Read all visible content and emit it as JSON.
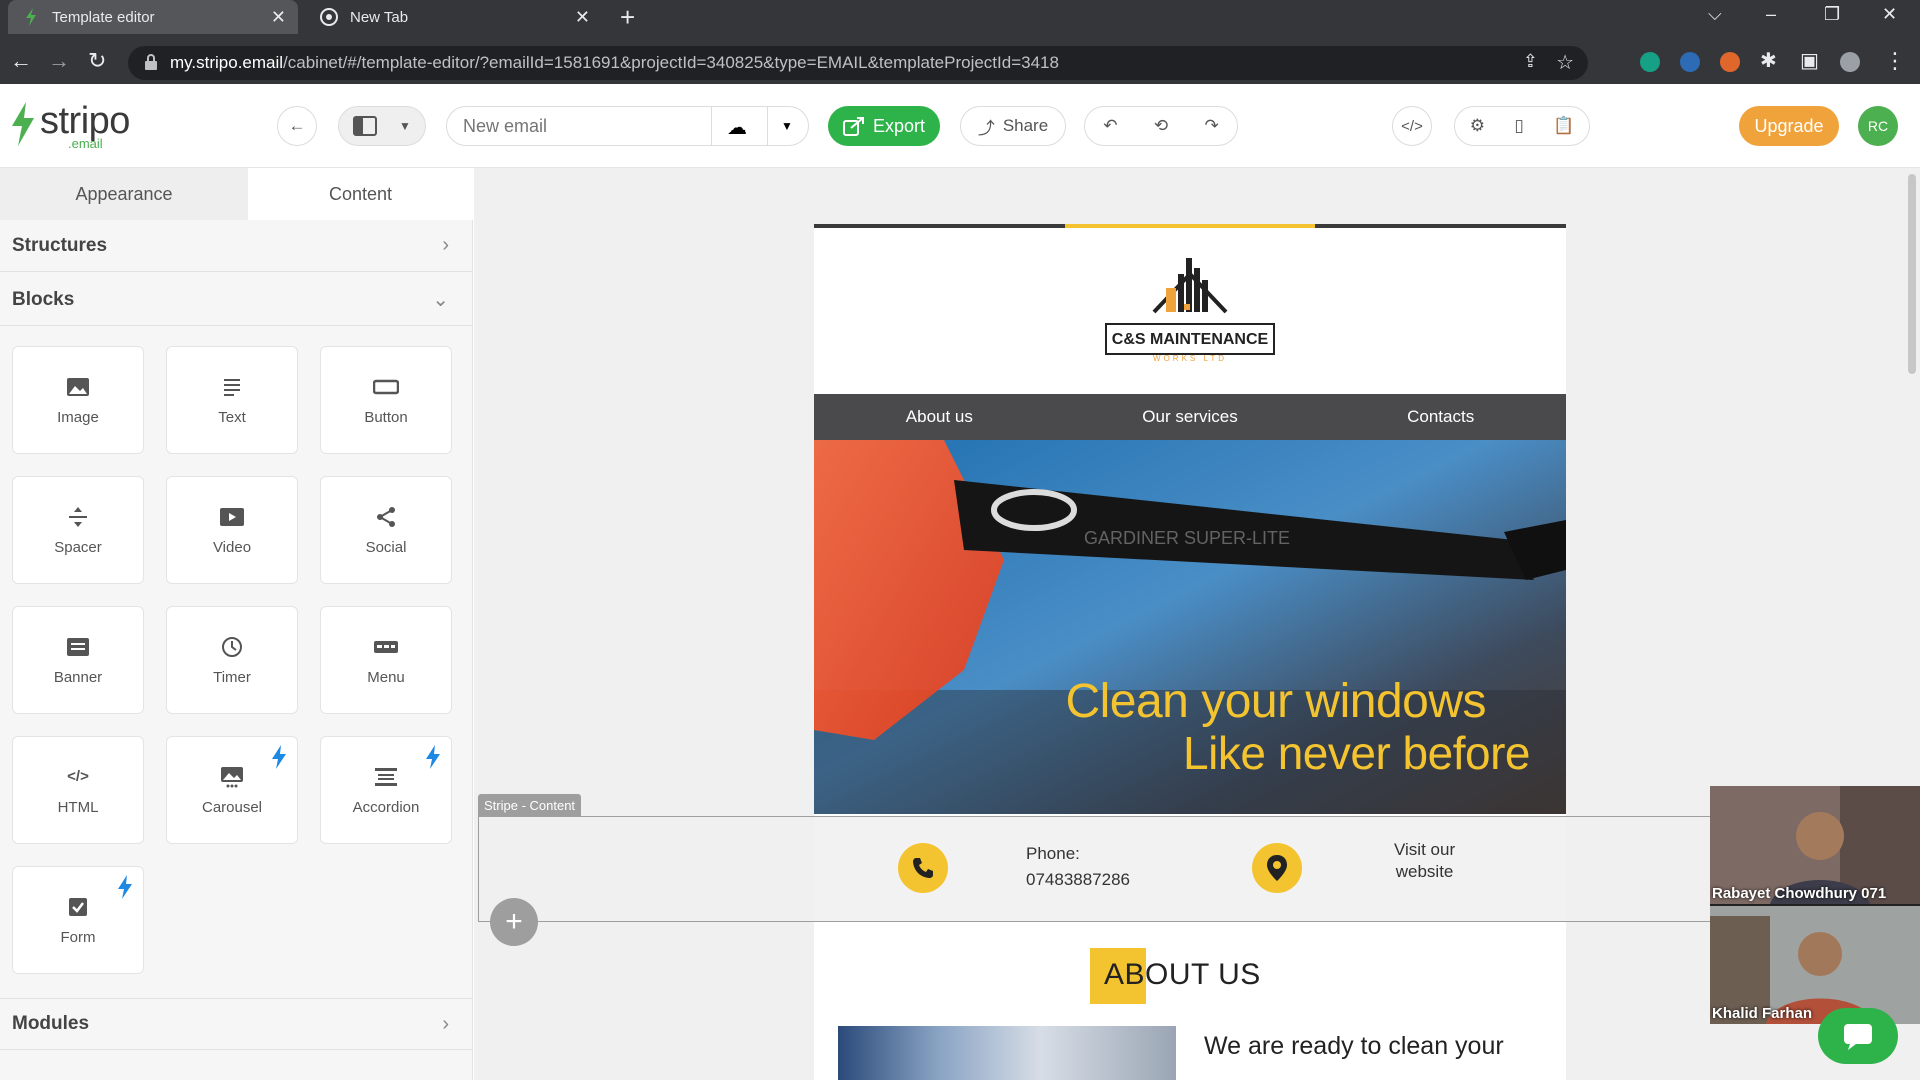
{
  "browser": {
    "tabs": [
      {
        "title": "Template editor",
        "active": true
      },
      {
        "title": "New Tab",
        "active": false
      }
    ],
    "url_host": "my.stripo.email",
    "url_path": "/cabinet/#/template-editor/?emailId=1581691&projectId=340825&type=EMAIL&templateProjectId=3418"
  },
  "toolbar": {
    "logo_text": "stripo",
    "logo_sub": ".email",
    "email_name_placeholder": "New email",
    "export_label": "Export",
    "share_label": "Share",
    "upgrade_label": "Upgrade",
    "avatar_initials": "RC"
  },
  "panel": {
    "tab_appearance": "Appearance",
    "tab_content": "Content",
    "section_structures": "Structures",
    "section_blocks": "Blocks",
    "section_modules": "Modules",
    "blocks": [
      {
        "label": "Image",
        "icon": "image-icon",
        "bolt": false
      },
      {
        "label": "Text",
        "icon": "text-icon",
        "bolt": false
      },
      {
        "label": "Button",
        "icon": "button-icon",
        "bolt": false
      },
      {
        "label": "Spacer",
        "icon": "spacer-icon",
        "bolt": false
      },
      {
        "label": "Video",
        "icon": "video-icon",
        "bolt": false
      },
      {
        "label": "Social",
        "icon": "social-icon",
        "bolt": false
      },
      {
        "label": "Banner",
        "icon": "banner-icon",
        "bolt": false
      },
      {
        "label": "Timer",
        "icon": "timer-icon",
        "bolt": false
      },
      {
        "label": "Menu",
        "icon": "menu-icon",
        "bolt": false
      },
      {
        "label": "HTML",
        "icon": "html-icon",
        "bolt": false
      },
      {
        "label": "Carousel",
        "icon": "carousel-icon",
        "bolt": true
      },
      {
        "label": "Accordion",
        "icon": "accordion-icon",
        "bolt": true
      },
      {
        "label": "Form",
        "icon": "form-icon",
        "bolt": true
      }
    ]
  },
  "email": {
    "logo_name": "C&S MAINTENANCE",
    "logo_sub": "WORKS LTD",
    "nav": [
      "About us",
      "Our services",
      "Contacts"
    ],
    "hero_line1": "Clean your windows",
    "hero_line2": "Like never before",
    "stripe_label": "Stripe - Content",
    "phone_label": "Phone:",
    "phone_number": "07483887286",
    "visit_line1": "Visit our",
    "visit_line2": "website",
    "about_title": "ABOUT US",
    "about_text": "We are ready to clean your"
  },
  "video_call": {
    "participant1": "Rabayet Chowdhury 071",
    "participant2": "Khalid Farhan"
  },
  "colors": {
    "accent_green": "#2eb34a",
    "upgrade_orange": "#f0a23b",
    "brand_yellow": "#f4c430"
  }
}
